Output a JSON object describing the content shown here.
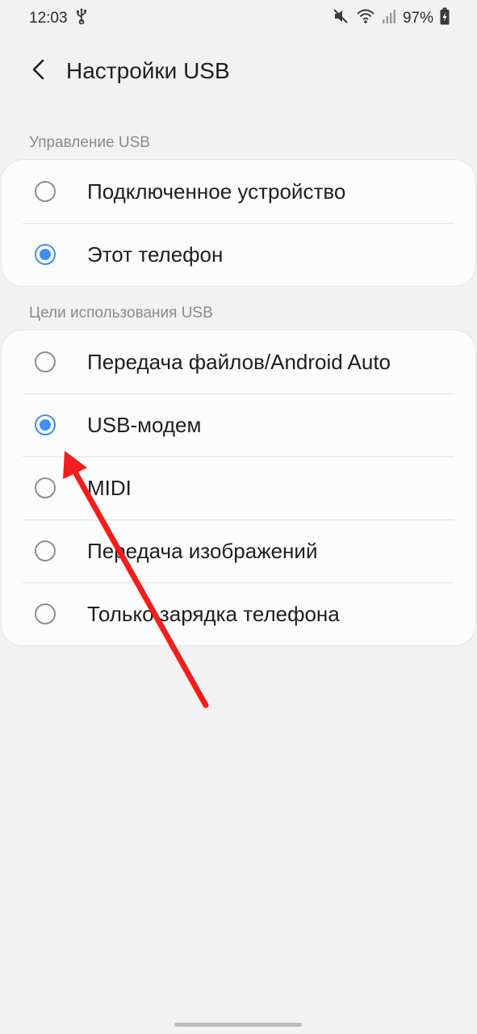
{
  "status_bar": {
    "time": "12:03",
    "usb_icon": "usb-icon",
    "mute_icon": "vibrate-off-icon",
    "wifi_icon": "wifi-icon",
    "signal_icon": "signal-icon",
    "battery_percent": "97%",
    "battery_icon": "battery-charging-icon"
  },
  "app_bar": {
    "back_icon": "chevron-left-icon",
    "title": "Настройки USB"
  },
  "sections": {
    "control": {
      "label": "Управление USB",
      "options": [
        {
          "label": "Подключенное устройство",
          "checked": false
        },
        {
          "label": "Этот телефон",
          "checked": true
        }
      ]
    },
    "purpose": {
      "label": "Цели использования USB",
      "options": [
        {
          "label": "Передача файлов/Android Auto",
          "checked": false
        },
        {
          "label": "USB-модем",
          "checked": true
        },
        {
          "label": "MIDI",
          "checked": false
        },
        {
          "label": "Передача изображений",
          "checked": false
        },
        {
          "label": "Только зарядка телефона",
          "checked": false
        }
      ]
    }
  },
  "colors": {
    "accent": "#3e8ef7",
    "arrow": "#f21d1d",
    "background": "#f2f2f2",
    "card": "#fcfcfc"
  }
}
